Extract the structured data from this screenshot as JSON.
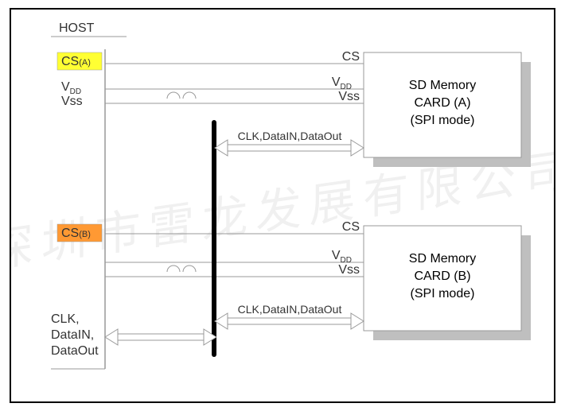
{
  "diagram": {
    "host_title": "HOST",
    "host": {
      "csA": "CS",
      "csA_sub": "(A)",
      "vdd": "V",
      "vdd_sub": "DD",
      "vss": "Vss",
      "csB": "CS",
      "csB_sub": "(B)",
      "bus1": "CLK,",
      "bus2": "DataIN,",
      "bus3": "DataOut"
    },
    "wires": {
      "csA": "CS",
      "csB": "CS",
      "vddA": "V",
      "vddA_sub": "DD",
      "vssA": "Vss",
      "vddB": "V",
      "vddB_sub": "DD",
      "vssB": "Vss",
      "busA": "CLK,DataIN,DataOut",
      "busB": "CLK,DataIN,DataOut"
    },
    "cardA": {
      "l1": "SD Memory",
      "l2": "CARD (A)",
      "l3": "(SPI mode)"
    },
    "cardB": {
      "l1": "SD Memory",
      "l2": "CARD (B)",
      "l3": "(SPI mode)"
    },
    "colors": {
      "csA": "#ffff33",
      "csB": "#ff9933",
      "shadow": "#bfbfbf",
      "line": "#999",
      "bus": "#000"
    },
    "watermark": "深圳市雷龙发展有限公司"
  }
}
